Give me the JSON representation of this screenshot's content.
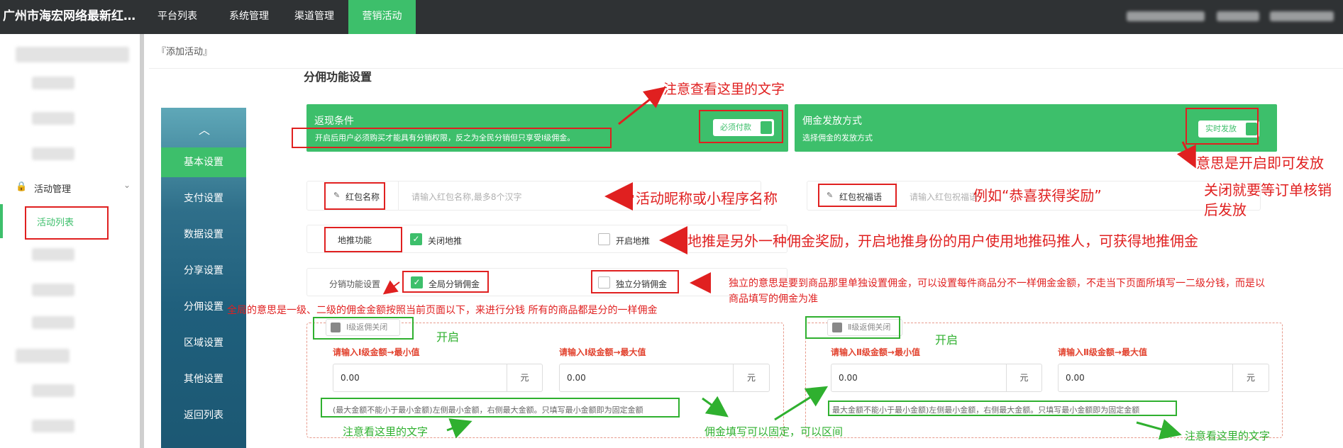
{
  "brand": "广州市海宏网络最新红…",
  "nav": [
    "平台列表",
    "系统管理",
    "渠道管理",
    "营销活动"
  ],
  "sidebar": {
    "group_label": "活动管理",
    "active_item": "活动列表"
  },
  "breadcrumb": "『添加活动』",
  "section_title": "分佣功能设置",
  "side_menu": [
    "基本设置",
    "支付设置",
    "数据设置",
    "分享设置",
    "分佣设置",
    "区域设置",
    "其他设置",
    "返回列表"
  ],
  "cards": {
    "return": {
      "title": "返现条件",
      "desc": "开启后用户必须购买才能具有分销权限，反之为全民分销但只享受Ⅰ级佣金。",
      "toggle": "必须付款"
    },
    "payout": {
      "title": "佣金发放方式",
      "desc": "选择佣金的发放方式",
      "toggle": "实时发放"
    }
  },
  "form": {
    "name_label": "红包名称",
    "name_placeholder": "请输入红包名称,最多8个汉字",
    "blessing_label": "红包祝福语",
    "blessing_placeholder": "请输入红包祝福语",
    "ground_label": "地推功能",
    "ground_off": "关闭地推",
    "ground_on": "开启地推",
    "dist_label": "分销功能设置",
    "dist_global": "全局分销佣金",
    "dist_independent": "独立分销佣金"
  },
  "levels": [
    {
      "toggle": "Ⅰ级返佣关闭",
      "min_label": "请输入Ⅰ级金额→最小值",
      "max_label": "请输入Ⅰ级金额→最大值",
      "min_value": "0.00",
      "max_value": "0.00",
      "unit": "元",
      "note": "(最大金额不能小于最小金额)左侧最小金额，右侧最大金额。只填写最小金额即为固定金额"
    },
    {
      "toggle": "Ⅱ级返佣关闭",
      "min_label": "请输入Ⅱ级金额→最小值",
      "max_label": "请输入Ⅱ级金额→最大值",
      "min_value": "0.00",
      "max_value": "0.00",
      "unit": "元",
      "note": "最大金额不能小于最小金额)左侧最小金额，右侧最大金额。只填写最小金额即为固定金额"
    }
  ],
  "annotations": {
    "a1": "注意查看这里的文字",
    "a2": "意思是开启即可发放",
    "a3": "关闭就要等订单核销",
    "a3b": "后发放",
    "a4": "活动昵称或小程序名称",
    "a5": "例如“恭喜获得奖励”",
    "a6": "地推是另外一种佣金奖励，开启地推身份的用户使用地推码推人，可获得地推佣金",
    "a7": "独立的意思是要到商品那里单独设置佣金，可以设置每件商品分不一样佣金金额，不走当下页面所填写一二级分钱，而是以",
    "a7b": "商品填写的佣金为准",
    "a8": "全局的意思是一级、二级的佣金金额按照当前页面以下，来进行分钱  所有的商品都是分的一样佣金",
    "a9": "开启",
    "a10": "开启",
    "a11": "注意看这里的文字",
    "a12": "佣金填写可以固定，可以区间",
    "a13": "注意看这里的文字"
  },
  "colors": {
    "accent": "#3dbf6b",
    "annotation_red": "#e02020",
    "annotation_green": "#2fb02f",
    "topbar": "#2f3234"
  }
}
